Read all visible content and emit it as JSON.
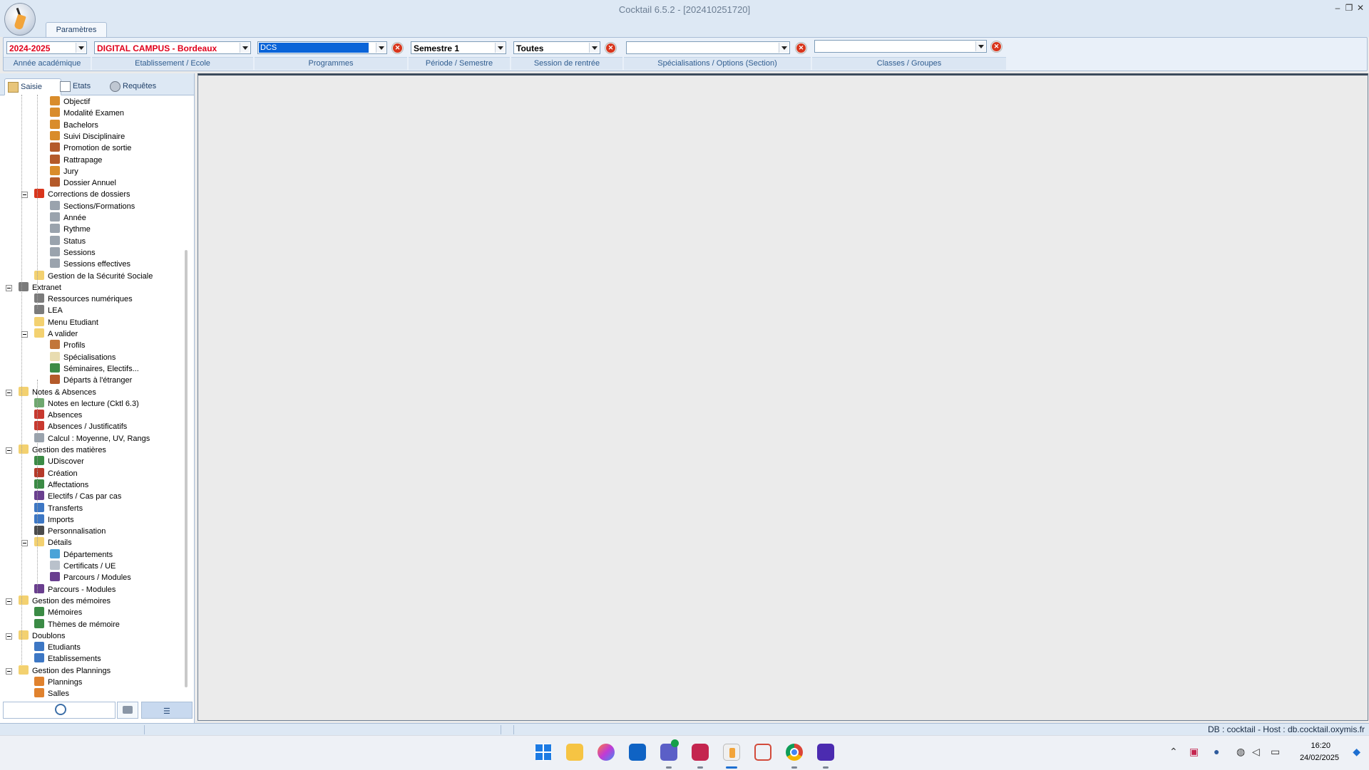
{
  "window": {
    "title": "Cocktail 6.5.2 -   [202410251720]",
    "minimize": "–",
    "restore": "❐",
    "close": "✕"
  },
  "ribbon": {
    "tab": "Paramètres"
  },
  "filters": {
    "annee": {
      "value": "2024-2025",
      "label": "Année académique",
      "color": "#e0001b"
    },
    "etablissement": {
      "value": "DIGITAL CAMPUS - Bordeaux",
      "label": "Etablissement / Ecole",
      "color": "#e0001b"
    },
    "programmes": {
      "value": "DCS",
      "label": "Programmes",
      "highlight": "#0a64d8"
    },
    "periode": {
      "value": "Semestre 1",
      "label": "Période / Semestre"
    },
    "session": {
      "value": "Toutes",
      "label": "Session de rentrée"
    },
    "specialisations": {
      "value": "",
      "label": "Spécialisations / Options (Section)"
    },
    "classes": {
      "value": "",
      "label": "Classes / Groupes"
    }
  },
  "left_tabs": [
    {
      "label": "Saisie"
    },
    {
      "label": "Etats"
    },
    {
      "label": "Requêtes"
    }
  ],
  "tree": [
    {
      "label": "Objectif",
      "icon": "handshake-icon"
    },
    {
      "label": "Modalité Examen",
      "icon": "handshake-icon"
    },
    {
      "label": "Bachelors",
      "icon": "handshake-icon"
    },
    {
      "label": "Suivi Disciplinaire",
      "icon": "handshake-icon"
    },
    {
      "label": "Promotion de sortie",
      "icon": "people-icon"
    },
    {
      "label": "Rattrapage",
      "icon": "people-icon"
    },
    {
      "label": "Jury",
      "icon": "handshake-icon"
    },
    {
      "label": "Dossier Annuel",
      "icon": "people-icon"
    },
    {
      "label": "Corrections de dossiers",
      "icon": "red-cross-icon"
    },
    {
      "label": "Sections/Formations",
      "icon": "wrench-icon"
    },
    {
      "label": "Année",
      "icon": "wrench-icon"
    },
    {
      "label": "Rythme",
      "icon": "wrench-icon"
    },
    {
      "label": "Status",
      "icon": "wrench-icon"
    },
    {
      "label": "Sessions",
      "icon": "wrench-icon"
    },
    {
      "label": "Sessions effectives",
      "icon": "wrench-icon"
    },
    {
      "label": "Gestion de la Sécurité Sociale",
      "icon": "folder-icon"
    },
    {
      "label": "Extranet",
      "icon": "gear-icon"
    },
    {
      "label": "Ressources numériques",
      "icon": "gear-icon"
    },
    {
      "label": "LEA",
      "icon": "gear-icon"
    },
    {
      "label": "Menu Etudiant",
      "icon": "folder-icon"
    },
    {
      "label": "A valider",
      "icon": "folder-open-icon"
    },
    {
      "label": "Profils",
      "icon": "person-icon"
    },
    {
      "label": "Spécialisations",
      "icon": "document-icon"
    },
    {
      "label": "Séminaires, Electifs...",
      "icon": "books-icon"
    },
    {
      "label": "Départs à l'étranger",
      "icon": "people-icon"
    },
    {
      "label": "Notes & Absences",
      "icon": "folder-open-icon"
    },
    {
      "label": "Notes en lecture (Cktl 6.3)",
      "icon": "grid-icon"
    },
    {
      "label": "Absences",
      "icon": "calendar-icon"
    },
    {
      "label": "Absences / Justificatifs",
      "icon": "calendar-icon"
    },
    {
      "label": "Calcul : Moyenne, UV, Rangs",
      "icon": "wrench-icon"
    },
    {
      "label": "Gestion des matières",
      "icon": "folder-open-icon"
    },
    {
      "label": "UDiscover",
      "icon": "books-icon"
    },
    {
      "label": "Création",
      "icon": "books-red-icon"
    },
    {
      "label": "Affectations",
      "icon": "books-icon"
    },
    {
      "label": "Electifs / Cas par cas",
      "icon": "books-purple-icon"
    },
    {
      "label": "Transferts",
      "icon": "transfer-icon"
    },
    {
      "label": "Imports",
      "icon": "import-icon"
    },
    {
      "label": "Personnalisation",
      "icon": "books-dark-icon"
    },
    {
      "label": "Détails",
      "icon": "folder-open-icon"
    },
    {
      "label": "Départements",
      "icon": "globe-icon"
    },
    {
      "label": "Certificats / UE",
      "icon": "certificate-icon"
    },
    {
      "label": "Parcours / Modules",
      "icon": "books-purple-icon"
    },
    {
      "label": "Parcours - Modules",
      "icon": "books-purple-icon"
    },
    {
      "label": "Gestion des mémoires",
      "icon": "folder-open-icon"
    },
    {
      "label": "Mémoires",
      "icon": "books-icon"
    },
    {
      "label": "Thèmes de mémoire",
      "icon": "books-icon"
    },
    {
      "label": "Doublons",
      "icon": "folder-open-icon"
    },
    {
      "label": "Etudiants",
      "icon": "person-blue-icon"
    },
    {
      "label": "Etablissements",
      "icon": "person-blue-icon"
    },
    {
      "label": "Gestion des Plannings",
      "icon": "folder-open-icon"
    },
    {
      "label": "Plannings",
      "icon": "shapes-icon"
    },
    {
      "label": "Salles",
      "icon": "shapes-icon"
    }
  ],
  "status": {
    "db": "DB : cocktail - Host : db.cocktail.oxymis.fr"
  },
  "taskbar": {
    "time": "16:20",
    "date": "24/02/2025"
  }
}
